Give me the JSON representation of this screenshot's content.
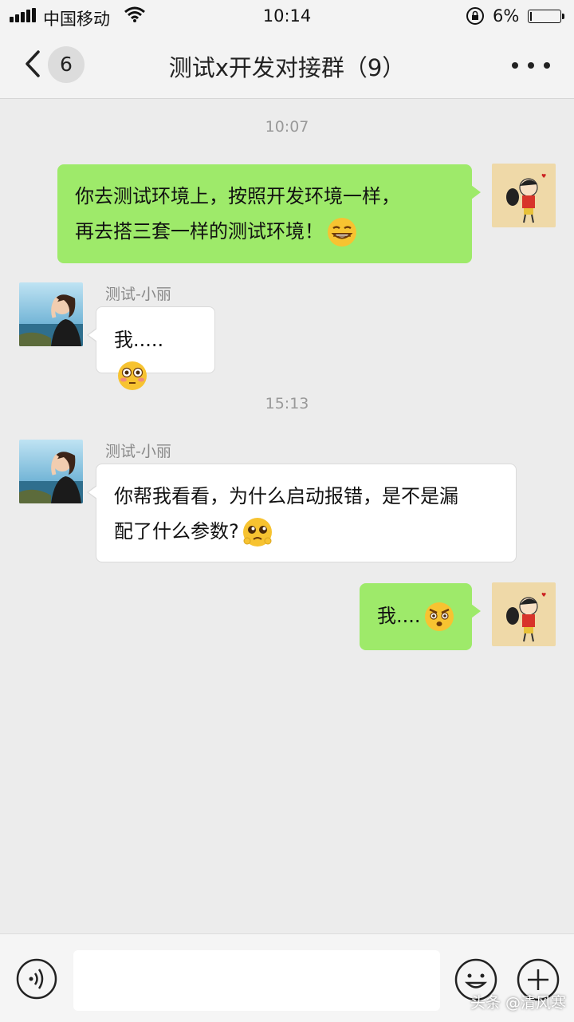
{
  "status_bar": {
    "carrier": "中国移动",
    "time": "10:14",
    "battery_percent": "6%",
    "battery_level": 0.06
  },
  "header": {
    "unread_count": "6",
    "title": "测试x开发对接群（9）"
  },
  "timestamps": [
    "10:07",
    "15:13"
  ],
  "messages": [
    {
      "direction": "outgoing",
      "lines": [
        "你去测试环境上，按照开发环境一样，",
        "再去搭三套一样的测试环境！"
      ],
      "emoji": "smirk-grin-emoji"
    },
    {
      "direction": "incoming",
      "sender": "测试-小丽",
      "lines": [
        "我....."
      ],
      "emoji": "flushed-emoji"
    },
    {
      "direction": "incoming",
      "sender": "测试-小丽",
      "lines": [
        "你帮我看看，为什么启动报错，是不是漏",
        "配了什么参数?"
      ],
      "emoji": "pleading-emoji"
    },
    {
      "direction": "outgoing",
      "lines": [
        "我...."
      ],
      "emoji": "angry-emoji"
    }
  ],
  "input_bar": {
    "voice_icon": "voice-icon",
    "emoji_icon": "emoji-face-icon",
    "plus_icon": "plus-icon"
  },
  "watermark": "头条 @清风寒",
  "colors": {
    "outgoing_bubble": "#9eea6a",
    "incoming_bubble": "#ffffff",
    "chat_background": "#ececec"
  }
}
